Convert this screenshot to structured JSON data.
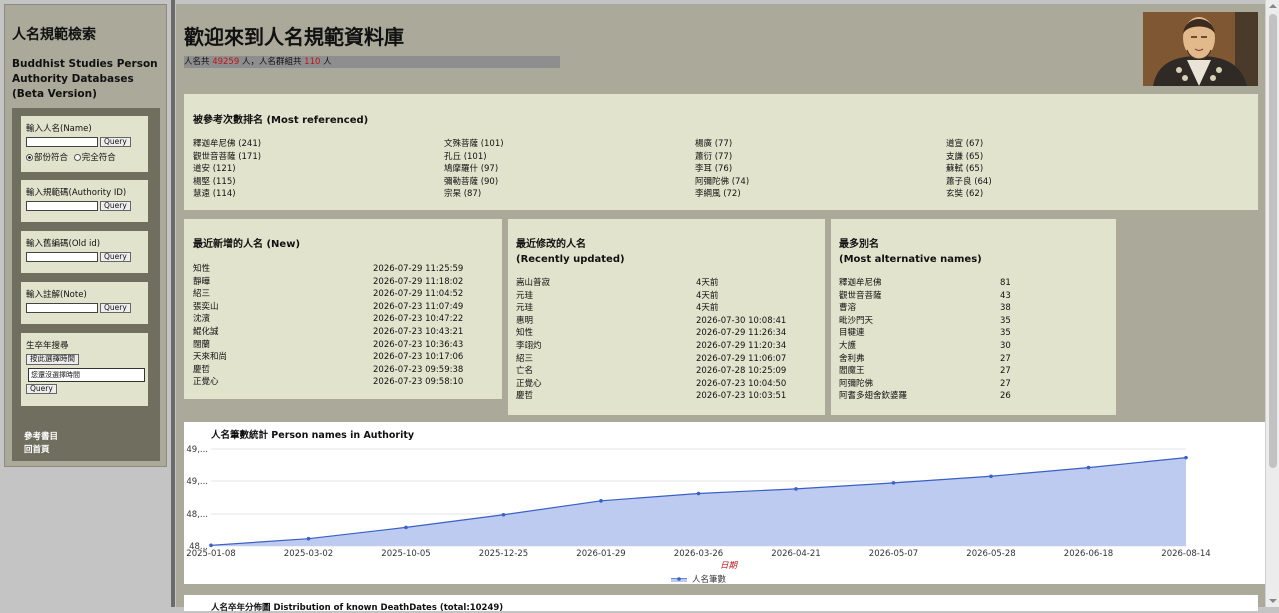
{
  "sidebar": {
    "title": "人名規範檢索",
    "subtitle": [
      "Buddhist Studies Person",
      "Authority Databases",
      "(Beta Version)"
    ],
    "name_search": {
      "label": "輸入人名(Name)",
      "query": "Query",
      "radio1": "部份符合",
      "radio2": "完全符合"
    },
    "authority_search": {
      "label": "輸入規範碼(Authority ID)",
      "query": "Query"
    },
    "oldid_search": {
      "label": "輸入舊編碼(Old id)",
      "query": "Query"
    },
    "note_search": {
      "label": "輸入註解(Note)",
      "query": "Query"
    },
    "year_search": {
      "label": "生卒年搜尋",
      "pick_button": "按此選擇時間",
      "selected_text": "您還沒選擇時間",
      "query": "Query"
    },
    "links": [
      "參考書目",
      "回首頁"
    ]
  },
  "main": {
    "title": "歡迎來到人名規範資料庫",
    "stats": {
      "prefix": "人名共 ",
      "names_count": "49259",
      "mid": " 人，人名群組共 ",
      "groups_count": "110",
      "suffix": " 人"
    }
  },
  "most_referenced": {
    "title": "被參考次數排名  (Most referenced)",
    "columns": [
      [
        "釋迦牟尼佛 (241)",
        "觀世音菩薩 (171)",
        "道安 (121)",
        "楊堅 (115)",
        "慧遠 (114)"
      ],
      [
        "文殊菩薩 (101)",
        "孔丘 (101)",
        "鳩摩羅什 (97)",
        "彌勒菩薩 (90)",
        "宗杲 (87)"
      ],
      [
        "楊廣 (77)",
        "蕭衍 (77)",
        "李耳 (76)",
        "阿彌陀佛 (74)",
        "李綱風 (72)"
      ],
      [
        "道宣 (67)",
        "支謙 (65)",
        "蘇軾 (65)",
        "蕭子良 (64)",
        "玄奘 (62)"
      ]
    ]
  },
  "newest": {
    "title": "最近新增的人名 (New)",
    "rows": [
      {
        "name": "知性",
        "time": "2026-07-29 11:25:59"
      },
      {
        "name": "靜曄",
        "time": "2026-07-29 11:18:02"
      },
      {
        "name": "紹三",
        "time": "2026-07-29 11:04:52"
      },
      {
        "name": "張奕山",
        "time": "2026-07-23 11:07:49"
      },
      {
        "name": "沈濱",
        "time": "2026-07-23 10:47:22"
      },
      {
        "name": "鯤化誠",
        "time": "2026-07-23 10:43:21"
      },
      {
        "name": "闊蘭",
        "time": "2026-07-23 10:36:43"
      },
      {
        "name": "天來和尚",
        "time": "2026-07-23 10:17:06"
      },
      {
        "name": "慶哲",
        "time": "2026-07-23 09:59:38"
      },
      {
        "name": "正覺心",
        "time": "2026-07-23 09:58:10"
      }
    ]
  },
  "recent": {
    "title1": "最近修改的人名",
    "title2": "(Recently updated)",
    "rows": [
      {
        "name": "嵩山普寂",
        "time": "4天前"
      },
      {
        "name": "元珪",
        "time": "4天前"
      },
      {
        "name": "元珪",
        "time": "4天前"
      },
      {
        "name": "惠明",
        "time": "2026-07-30 10:08:41"
      },
      {
        "name": "知性",
        "time": "2026-07-29 11:26:34"
      },
      {
        "name": "李翊灼",
        "time": "2026-07-29 11:20:34"
      },
      {
        "name": "紹三",
        "time": "2026-07-29 11:06:07"
      },
      {
        "name": "亡名",
        "time": "2026-07-28 10:25:09"
      },
      {
        "name": "正覺心",
        "time": "2026-07-23 10:04:50"
      },
      {
        "name": "慶哲",
        "time": "2026-07-23 10:03:51"
      }
    ]
  },
  "alt_names": {
    "title1": "最多別名",
    "title2": "(Most alternative names)",
    "rows": [
      {
        "name": "釋迦牟尼佛",
        "count": "81"
      },
      {
        "name": "觀世音菩薩",
        "count": "43"
      },
      {
        "name": "曹溶",
        "count": "38"
      },
      {
        "name": "毗沙門天",
        "count": "35"
      },
      {
        "name": "目犍連",
        "count": "35"
      },
      {
        "name": "大護",
        "count": "30"
      },
      {
        "name": "舍利弗",
        "count": "27"
      },
      {
        "name": "閻魔王",
        "count": "27"
      },
      {
        "name": "阿彌陀佛",
        "count": "27"
      },
      {
        "name": "阿耆多翅舍欽婆羅",
        "count": "26"
      }
    ]
  },
  "chart_data": {
    "type": "area",
    "title": "人名筆數統計 Person names in Authority",
    "xlabel": "日期",
    "x": [
      "2025-01-08",
      "2025-03-02",
      "2025-10-05",
      "2025-12-25",
      "2026-01-29",
      "2026-03-26",
      "2026-04-21",
      "2026-05-07",
      "2026-05-28",
      "2026-06-18",
      "2026-08-14"
    ],
    "series": [
      {
        "name": "人名筆數",
        "values": [
          48010,
          48110,
          48280,
          48470,
          48680,
          48790,
          48860,
          48950,
          49050,
          49180,
          49330
        ]
      }
    ],
    "ytick_labels": [
      "49,...",
      "49,...",
      "48,...",
      "48..."
    ],
    "ylim": [
      48000,
      49460
    ],
    "colors": {
      "line": "#3a5fc6",
      "fill": "#bccbef",
      "xlabel": "#c0121a"
    },
    "grid": true,
    "legend": "bottom"
  },
  "bottom_panel": {
    "title": "人名卒年分佈圖 Distribution of known DeathDates (total:10249)"
  }
}
